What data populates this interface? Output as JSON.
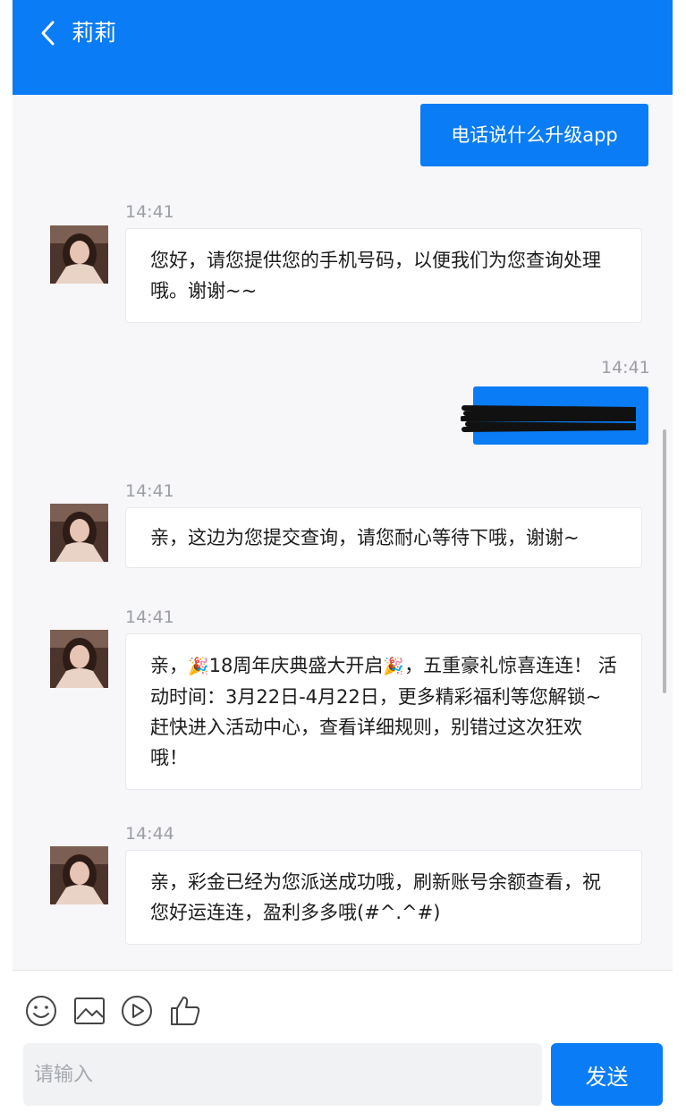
{
  "header": {
    "title": "莉莉",
    "back_icon": "chevron-left-icon",
    "color": "#0a7cf5"
  },
  "messages": [
    {
      "from": "me",
      "text": "电话说什么升级app"
    },
    {
      "from": "agent",
      "time": "14:41",
      "text": "您好，请您提供您的手机号码，以便我们为您查询处理哦。谢谢~~"
    },
    {
      "from": "me",
      "time": "14:41",
      "text": "",
      "redacted": true
    },
    {
      "from": "agent",
      "time": "14:41",
      "text": "亲，这边为您提交查询，请您耐心等待下哦，谢谢~"
    },
    {
      "from": "agent",
      "time": "14:41",
      "parts": [
        "亲，",
        "18周年庆典盛大开启",
        "，五重豪礼惊喜连连！ 活动时间：3月22日-4月22日，更多精彩福利等您解锁~ 赶快进入活动中心，查看详细规则，别错过这次狂欢哦！"
      ],
      "emoji": "🎉"
    },
    {
      "from": "agent",
      "time": "14:44",
      "text": "亲，彩金已经为您派送成功哦，刷新账号余额查看，祝您好运连连，盈利多多哦(#^.^#)"
    }
  ],
  "toolbar": {
    "icons": [
      "emoji-icon",
      "image-icon",
      "video-icon",
      "thumbs-up-icon"
    ]
  },
  "composer": {
    "placeholder": "请输入",
    "send_label": "发送"
  }
}
